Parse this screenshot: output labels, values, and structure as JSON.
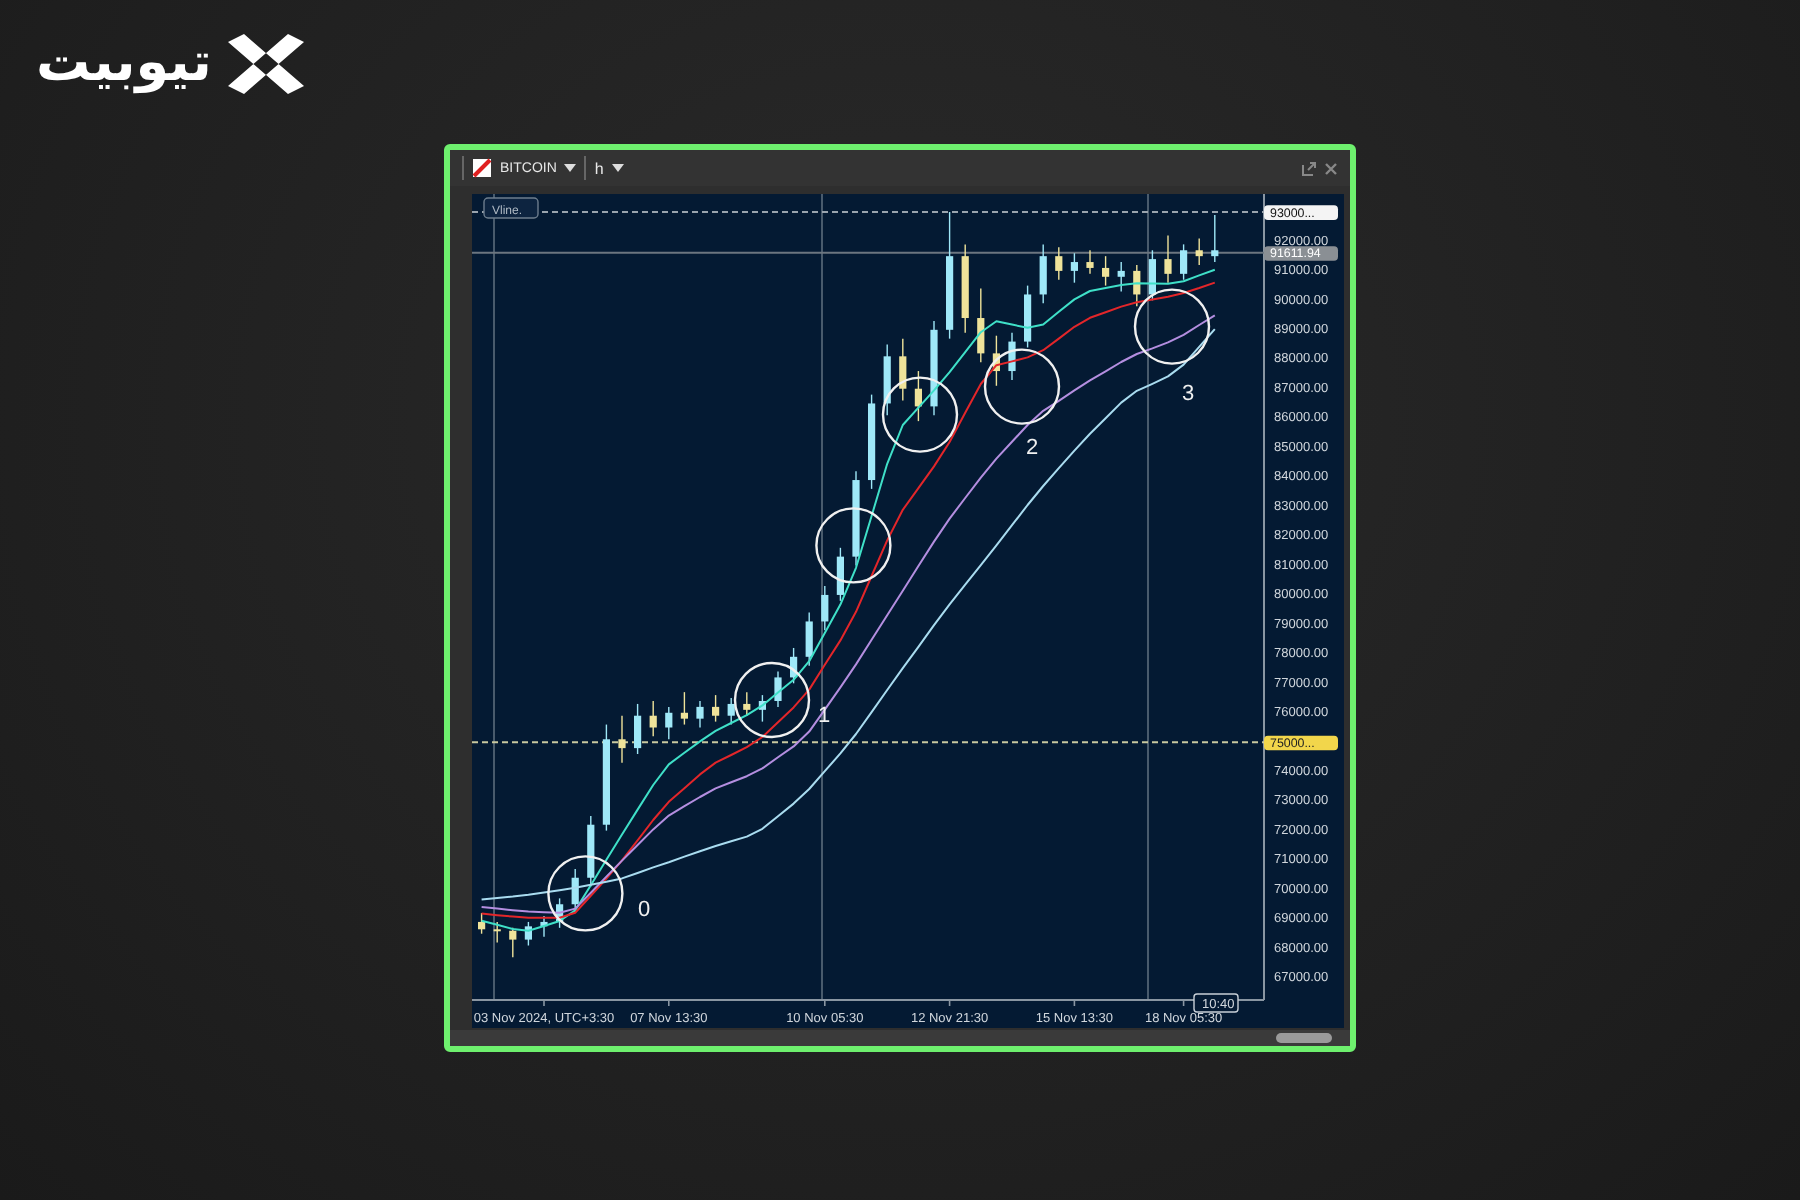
{
  "logo": {
    "text": "تیوبیت"
  },
  "window": {
    "symbol": "BITCOIN",
    "timeframe": "h"
  },
  "chart": {
    "vline_label": "Vline.",
    "chart_data": {
      "type": "candlestick",
      "categories": [
        null,
        null,
        null,
        null,
        "03 Nov 2024, UTC+3:30",
        null,
        null,
        null,
        null,
        null,
        null,
        null,
        "07 Nov 13:30",
        null,
        null,
        null,
        null,
        null,
        null,
        null,
        null,
        null,
        "10 Nov 05:30",
        null,
        null,
        null,
        null,
        null,
        null,
        null,
        "12 Nov 21:30",
        null,
        null,
        null,
        null,
        null,
        null,
        null,
        "15 Nov 13:30",
        null,
        null,
        null,
        null,
        null,
        null,
        "18 Nov 05:30",
        null,
        null
      ],
      "ylim": [
        66250,
        93610
      ],
      "ref_lines": [
        {
          "axis": "y",
          "value": 93000
        },
        {
          "axis": "y",
          "value": 91611.94
        },
        {
          "axis": "y",
          "value": 75000
        }
      ],
      "yticks": [
        {
          "value": 92000,
          "label": "92000.00"
        },
        {
          "value": 91000,
          "label": "91000.00"
        },
        {
          "value": 90000,
          "label": "90000.00"
        },
        {
          "value": 89000,
          "label": "89000.00"
        },
        {
          "value": 88000,
          "label": "88000.00"
        },
        {
          "value": 87000,
          "label": "87000.00"
        },
        {
          "value": 86000,
          "label": "86000.00"
        },
        {
          "value": 85000,
          "label": "85000.00"
        },
        {
          "value": 84000,
          "label": "84000.00"
        },
        {
          "value": 83000,
          "label": "83000.00"
        },
        {
          "value": 82000,
          "label": "82000.00"
        },
        {
          "value": 81000,
          "label": "81000.00"
        },
        {
          "value": 80000,
          "label": "80000.00"
        },
        {
          "value": 79000,
          "label": "79000.00"
        },
        {
          "value": 78000,
          "label": "78000.00"
        },
        {
          "value": 77000,
          "label": "77000.00"
        },
        {
          "value": 76000,
          "label": "76000.00"
        },
        {
          "value": 74000,
          "label": "74000.00"
        },
        {
          "value": 73000,
          "label": "73000.00"
        },
        {
          "value": 72000,
          "label": "72000.00"
        },
        {
          "value": 71000,
          "label": "71000.00"
        },
        {
          "value": 70000,
          "label": "70000.00"
        },
        {
          "value": 69000,
          "label": "69000.00"
        },
        {
          "value": 68000,
          "label": "68000.00"
        },
        {
          "value": 67000,
          "label": "67000.00"
        }
      ],
      "ohlc": [
        [
          68900,
          69200,
          68500,
          68650
        ],
        [
          68650,
          68900,
          68200,
          68600
        ],
        [
          68600,
          68700,
          67700,
          68300
        ],
        [
          68300,
          68900,
          68100,
          68750
        ],
        [
          68750,
          69100,
          68400,
          68900
        ],
        [
          68900,
          69700,
          68700,
          69500
        ],
        [
          69500,
          70700,
          69200,
          70400
        ],
        [
          70400,
          72500,
          70100,
          72200
        ],
        [
          72200,
          75600,
          72000,
          75100
        ],
        [
          75100,
          75900,
          74300,
          74800
        ],
        [
          74800,
          76300,
          74600,
          75900
        ],
        [
          75900,
          76400,
          75200,
          75500
        ],
        [
          75500,
          76200,
          75100,
          76000
        ],
        [
          76000,
          76700,
          75600,
          75800
        ],
        [
          75800,
          76400,
          75500,
          76200
        ],
        [
          76200,
          76600,
          75700,
          75900
        ],
        [
          75900,
          76500,
          75600,
          76300
        ],
        [
          76300,
          76700,
          75900,
          76100
        ],
        [
          76100,
          76600,
          75700,
          76400
        ],
        [
          76400,
          77400,
          76200,
          77200
        ],
        [
          77200,
          78200,
          77000,
          77900
        ],
        [
          77900,
          79400,
          77600,
          79100
        ],
        [
          79100,
          80300,
          78800,
          80000
        ],
        [
          80000,
          81600,
          79800,
          81300
        ],
        [
          81300,
          84200,
          81000,
          83900
        ],
        [
          83900,
          86800,
          83600,
          86500
        ],
        [
          86500,
          88500,
          86100,
          88100
        ],
        [
          88100,
          88700,
          86600,
          87000
        ],
        [
          87000,
          87600,
          85900,
          86400
        ],
        [
          86400,
          89300,
          86100,
          89000
        ],
        [
          89000,
          93000,
          88700,
          91500
        ],
        [
          91500,
          91900,
          88900,
          89400
        ],
        [
          89400,
          90400,
          87900,
          88200
        ],
        [
          88200,
          88800,
          87100,
          87600
        ],
        [
          87600,
          88900,
          87300,
          88600
        ],
        [
          88600,
          90500,
          88400,
          90200
        ],
        [
          90200,
          91900,
          89900,
          91500
        ],
        [
          91500,
          91800,
          90700,
          91000
        ],
        [
          91000,
          91600,
          90600,
          91300
        ],
        [
          91300,
          91700,
          90900,
          91100
        ],
        [
          91100,
          91500,
          90500,
          90800
        ],
        [
          90800,
          91300,
          90300,
          91000
        ],
        [
          91000,
          91200,
          89800,
          90200
        ],
        [
          90200,
          91700,
          90000,
          91400
        ],
        [
          91400,
          92200,
          90600,
          90900
        ],
        [
          90900,
          91900,
          90700,
          91700
        ],
        [
          91700,
          92100,
          91200,
          91500
        ],
        [
          91500,
          92900,
          91300,
          91700
        ]
      ],
      "series": [
        {
          "type": "line",
          "color": "#3fe0c8",
          "values": [
            68940,
            68800,
            68660,
            68600,
            68760,
            68930,
            69290,
            70150,
            71010,
            71870,
            72710,
            73550,
            74250,
            74640,
            75030,
            75390,
            75650,
            75920,
            76250,
            76690,
            77120,
            77750,
            78710,
            79670,
            80920,
            82680,
            84450,
            85770,
            86360,
            86940,
            87560,
            88240,
            88920,
            89290,
            89180,
            89070,
            89180,
            89610,
            90030,
            90320,
            90420,
            90520,
            90580,
            90570,
            90560,
            90650,
            90850,
            91040
          ]
        },
        {
          "type": "line",
          "color": "#e3262a",
          "values": [
            69180,
            69130,
            69080,
            69040,
            69040,
            69040,
            69210,
            69790,
            70370,
            70990,
            71670,
            72360,
            72980,
            73440,
            73910,
            74310,
            74570,
            74830,
            75180,
            75680,
            76180,
            76790,
            77630,
            78460,
            79430,
            80640,
            81850,
            82890,
            83620,
            84360,
            85190,
            86180,
            87160,
            87800,
            87930,
            88060,
            88310,
            88700,
            89100,
            89410,
            89600,
            89790,
            89940,
            90030,
            90120,
            90250,
            90420,
            90600
          ]
        },
        {
          "type": "line",
          "color": "#b48ee0",
          "values": [
            69410,
            69350,
            69300,
            69250,
            69230,
            69210,
            69350,
            69890,
            70440,
            70980,
            71510,
            72040,
            72510,
            72830,
            73140,
            73430,
            73640,
            73850,
            74110,
            74490,
            74860,
            75360,
            76110,
            76860,
            77640,
            78480,
            79310,
            80140,
            80980,
            81810,
            82590,
            83290,
            83980,
            84630,
            85200,
            85770,
            86250,
            86590,
            86940,
            87280,
            87590,
            87910,
            88180,
            88370,
            88570,
            88830,
            89160,
            89490
          ]
        },
        {
          "type": "line",
          "color": "#a9dcf0",
          "values": [
            69660,
            69710,
            69760,
            69820,
            69900,
            69980,
            70060,
            70160,
            70260,
            70380,
            70560,
            70750,
            70930,
            71120,
            71300,
            71480,
            71640,
            71800,
            72060,
            72490,
            72920,
            73410,
            74020,
            74620,
            75280,
            76020,
            76770,
            77510,
            78240,
            78970,
            79680,
            80350,
            81010,
            81680,
            82370,
            83050,
            83700,
            84300,
            84900,
            85470,
            86000,
            86530,
            86930,
            87170,
            87420,
            87820,
            88420,
            89020
          ]
        }
      ]
    },
    "tags": [
      {
        "kind": "line",
        "text": "93000..."
      },
      {
        "kind": "last",
        "text": "91611.94"
      },
      {
        "kind": "alert",
        "text": "75000..."
      }
    ],
    "time_tag": "10:40",
    "markers": [
      "0",
      "1",
      "2",
      "3"
    ]
  }
}
